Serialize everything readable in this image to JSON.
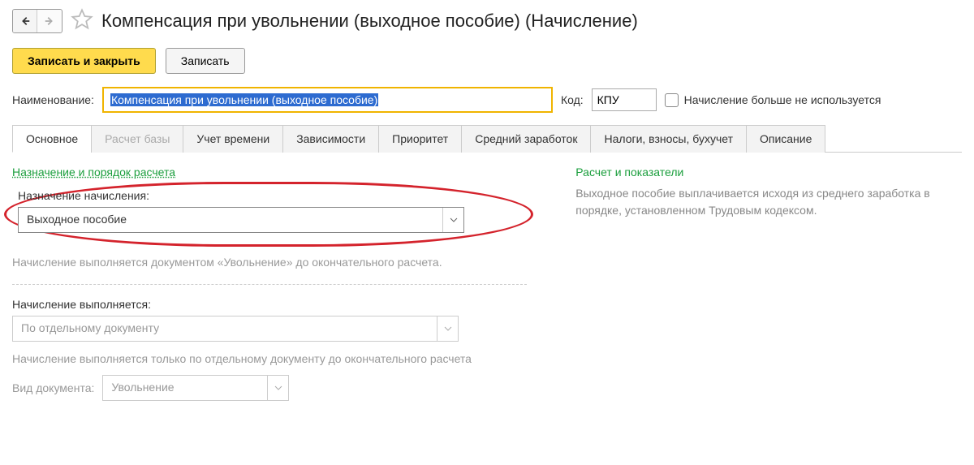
{
  "header": {
    "title": "Компенсация при увольнении (выходное пособие) (Начисление)"
  },
  "toolbar": {
    "save_close": "Записать и закрыть",
    "save": "Записать"
  },
  "fields": {
    "name_label": "Наименование:",
    "name_value": "Компенсация при увольнении (выходное пособие)",
    "code_label": "Код:",
    "code_value": "КПУ",
    "not_used_label": "Начисление больше не используется"
  },
  "tabs": [
    "Основное",
    "Расчет базы",
    "Учет времени",
    "Зависимости",
    "Приоритет",
    "Средний заработок",
    "Налоги, взносы, бухучет",
    "Описание"
  ],
  "main": {
    "section1_heading": "Назначение и порядок расчета",
    "purpose_label": "Назначение начисления:",
    "purpose_value": "Выходное пособие",
    "purpose_note": "Начисление выполняется документом «Увольнение» до окончательного расчета.",
    "execution_label": "Начисление выполняется:",
    "execution_value": "По отдельному документу",
    "execution_note": "Начисление выполняется только по отдельному документу до окончательного расчета",
    "doc_type_label": "Вид документа:",
    "doc_type_value": "Увольнение"
  },
  "right": {
    "heading": "Расчет и показатели",
    "text": "Выходное пособие выплачивается исходя из среднего заработка в порядке, установленном Трудовым кодексом."
  }
}
